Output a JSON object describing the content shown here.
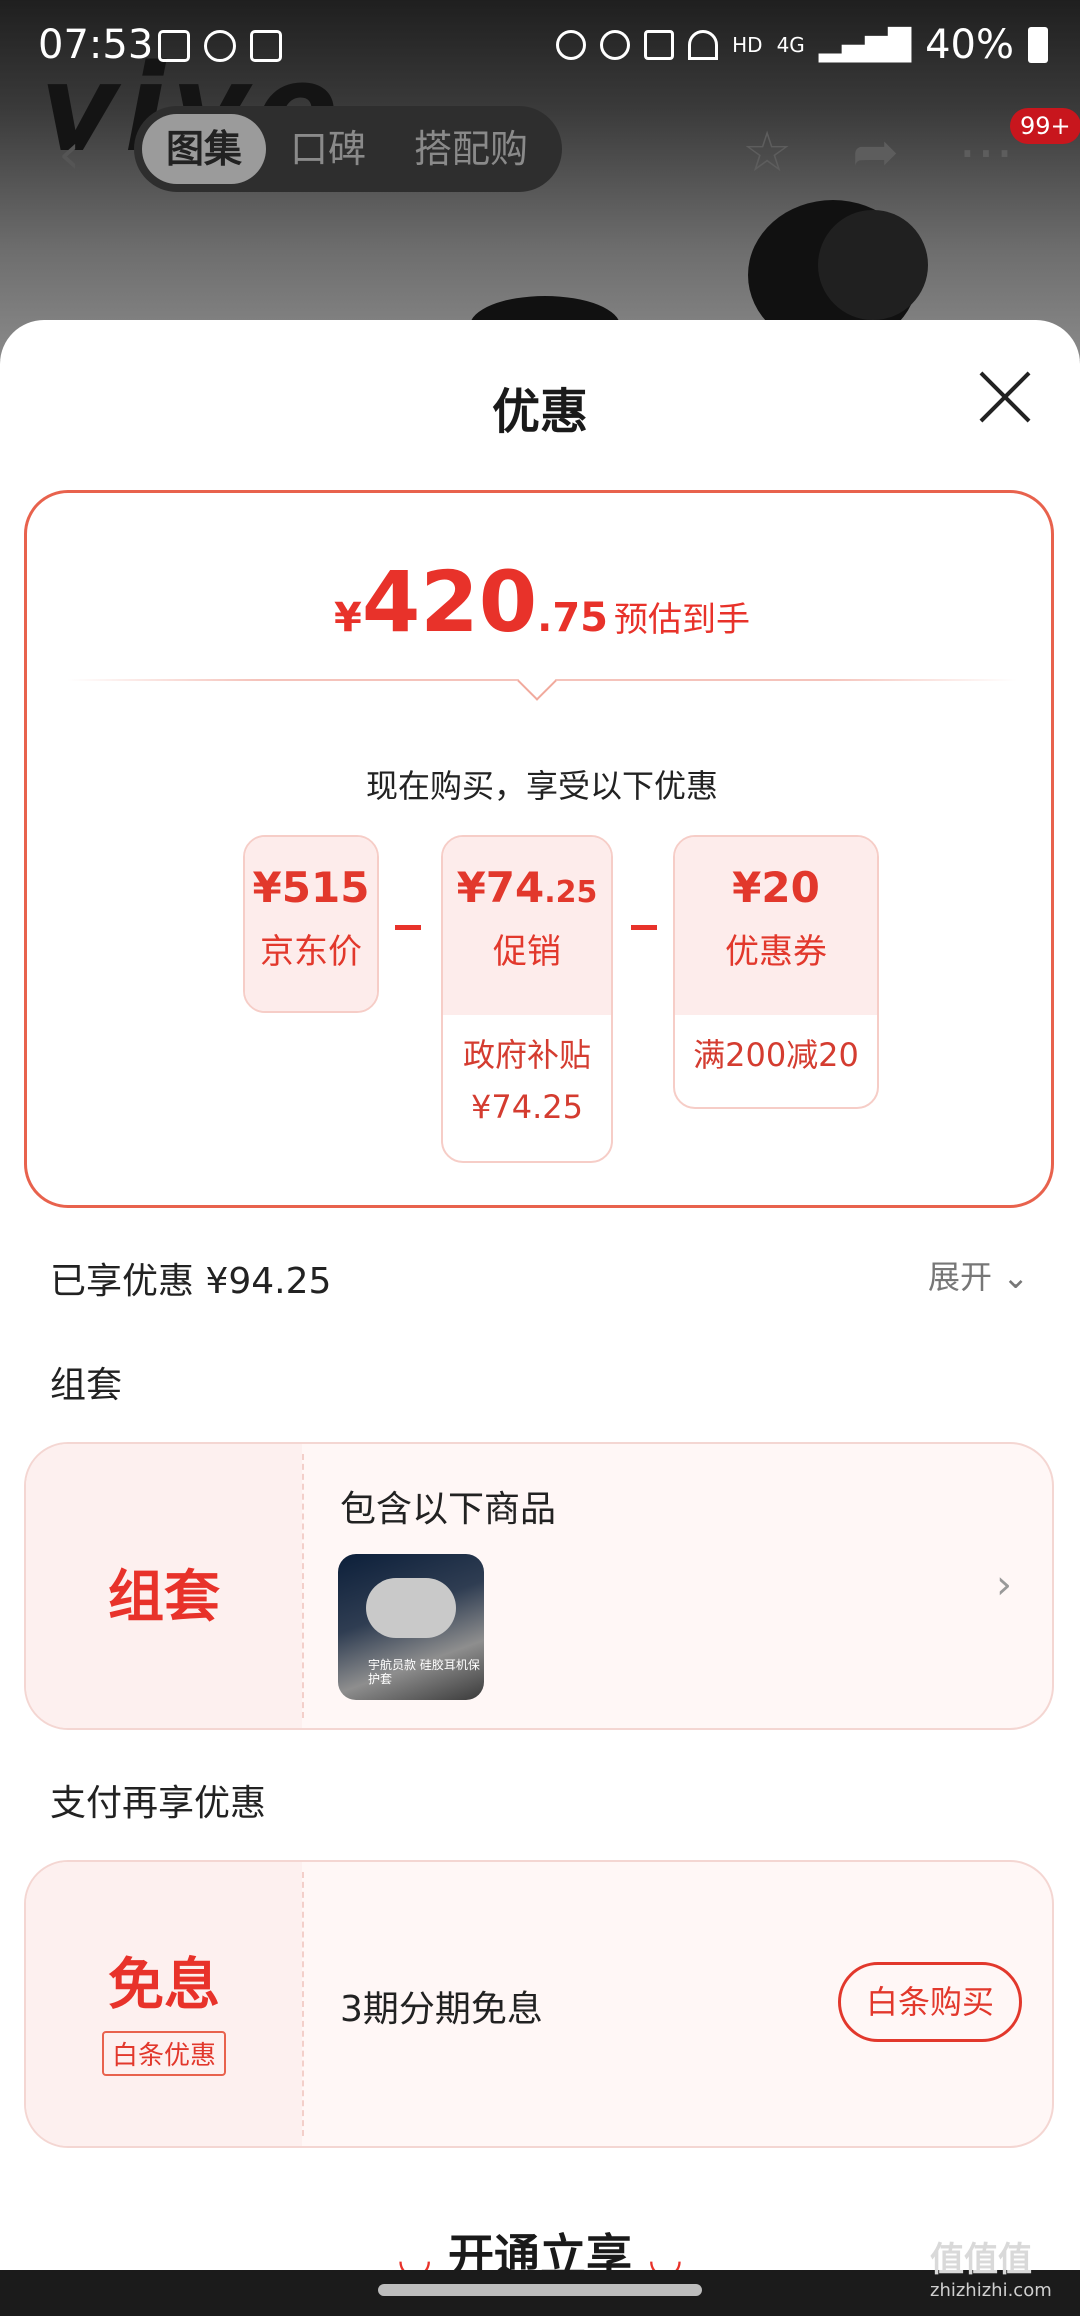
{
  "status_bar": {
    "time": "07:53",
    "network": "HD",
    "network_gen": "4G",
    "battery": "40%"
  },
  "nav": {
    "tabs": [
      "图集",
      "口碑",
      "搭配购"
    ],
    "active_tab": 0,
    "cart_badge": "99+",
    "bg_brand": "vivo"
  },
  "sheet": {
    "title": "优惠",
    "price": {
      "currency": "¥",
      "integer": "420",
      "decimal": ".75",
      "label": "预估到手"
    },
    "enjoy_text": "现在购买，享受以下优惠",
    "chips": [
      {
        "amount": "¥515",
        "label": "京东价",
        "sub": []
      },
      {
        "amount": "¥74",
        "amount_small": ".25",
        "label": "促销",
        "sub": [
          "政府补贴",
          "¥74.25"
        ]
      },
      {
        "amount": "¥20",
        "label": "优惠券",
        "sub": [
          "满200减20"
        ]
      }
    ],
    "saved": "已享优惠 ¥94.25",
    "expand": "展开",
    "bundle_section": "组套",
    "bundle": {
      "tag": "组套",
      "title": "包含以下商品",
      "thumb_caption": "宇航员款 硅胶耳机保护套"
    },
    "pay_section": "支付再享优惠",
    "pay": {
      "tag": "免息",
      "sub_tag": "白条优惠",
      "text": "3期分期免息",
      "button": "白条购买"
    },
    "cta": "开通立享"
  },
  "watermark": {
    "text": "值值值",
    "url": "zhizhizhi.com"
  },
  "colors": {
    "accent": "#e8322a",
    "card_tint": "#fdeceb"
  }
}
